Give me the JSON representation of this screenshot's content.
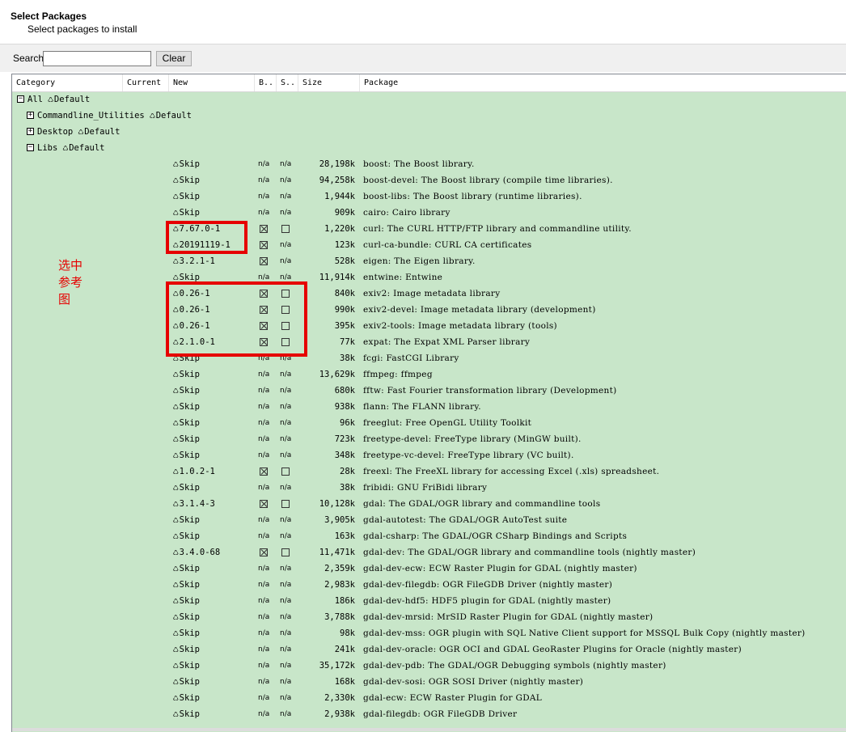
{
  "header": {
    "title": "Select Packages",
    "subtitle": "Select packages to install"
  },
  "search": {
    "label": "Search",
    "value": "",
    "placeholder": "",
    "clear_label": "Clear"
  },
  "columns": [
    "Category",
    "Current",
    "New",
    "B..",
    "S..",
    "Size",
    "Package"
  ],
  "tree": [
    {
      "expander": "⊟",
      "label": "All",
      "action": "Default"
    },
    {
      "expander": "⊞",
      "label": "Commandline_Utilities",
      "action": "Default"
    },
    {
      "expander": "⊞",
      "label": "Desktop",
      "action": "Default"
    },
    {
      "expander": "⊟",
      "label": "Libs",
      "action": "Default"
    }
  ],
  "annotation": "选中参考图",
  "packages": [
    {
      "new": "Skip",
      "bin": "n/a",
      "src": "n/a",
      "size": "28,198k",
      "package": "boost: The Boost library."
    },
    {
      "new": "Skip",
      "bin": "n/a",
      "src": "n/a",
      "size": "94,258k",
      "package": "boost-devel: The Boost library (compile time libraries)."
    },
    {
      "new": "Skip",
      "bin": "n/a",
      "src": "n/a",
      "size": "1,944k",
      "package": "boost-libs: The Boost library (runtime libraries)."
    },
    {
      "new": "Skip",
      "bin": "n/a",
      "src": "n/a",
      "size": "909k",
      "package": "cairo: Cairo library"
    },
    {
      "new": "7.67.0-1",
      "bin": "checked",
      "src": "unchecked",
      "size": "1,220k",
      "package": "curl: The CURL HTTP/FTP library and commandline utility."
    },
    {
      "new": "20191119-1",
      "bin": "checked",
      "src": "n/a",
      "size": "123k",
      "package": "curl-ca-bundle: CURL CA certificates"
    },
    {
      "new": "3.2.1-1",
      "bin": "checked",
      "src": "n/a",
      "size": "528k",
      "package": "eigen: The Eigen library."
    },
    {
      "new": "Skip",
      "bin": "n/a",
      "src": "n/a",
      "size": "11,914k",
      "package": "entwine: Entwine"
    },
    {
      "new": "0.26-1",
      "bin": "checked",
      "src": "unchecked",
      "size": "840k",
      "package": "exiv2: Image metadata library"
    },
    {
      "new": "0.26-1",
      "bin": "checked",
      "src": "unchecked",
      "size": "990k",
      "package": "exiv2-devel: Image metadata library (development)"
    },
    {
      "new": "0.26-1",
      "bin": "checked",
      "src": "unchecked",
      "size": "395k",
      "package": "exiv2-tools: Image metadata library (tools)"
    },
    {
      "new": "2.1.0-1",
      "bin": "checked",
      "src": "unchecked",
      "size": "77k",
      "package": "expat: The Expat XML Parser library"
    },
    {
      "new": "Skip",
      "bin": "n/a",
      "src": "n/a",
      "size": "38k",
      "package": "fcgi: FastCGI Library"
    },
    {
      "new": "Skip",
      "bin": "n/a",
      "src": "n/a",
      "size": "13,629k",
      "package": "ffmpeg: ffmpeg"
    },
    {
      "new": "Skip",
      "bin": "n/a",
      "src": "n/a",
      "size": "680k",
      "package": "fftw: Fast Fourier transformation library (Development)"
    },
    {
      "new": "Skip",
      "bin": "n/a",
      "src": "n/a",
      "size": "938k",
      "package": "flann: The FLANN library."
    },
    {
      "new": "Skip",
      "bin": "n/a",
      "src": "n/a",
      "size": "96k",
      "package": "freeglut: Free OpenGL Utility Toolkit"
    },
    {
      "new": "Skip",
      "bin": "n/a",
      "src": "n/a",
      "size": "723k",
      "package": "freetype-devel: FreeType library (MinGW built)."
    },
    {
      "new": "Skip",
      "bin": "n/a",
      "src": "n/a",
      "size": "348k",
      "package": "freetype-vc-devel: FreeType library (VC built)."
    },
    {
      "new": "1.0.2-1",
      "bin": "checked",
      "src": "unchecked",
      "size": "28k",
      "package": "freexl: The FreeXL library for accessing Excel (.xls) spreadsheet."
    },
    {
      "new": "Skip",
      "bin": "n/a",
      "src": "n/a",
      "size": "38k",
      "package": "fribidi: GNU FriBidi library"
    },
    {
      "new": "3.1.4-3",
      "bin": "checked",
      "src": "unchecked",
      "size": "10,128k",
      "package": "gdal: The GDAL/OGR library and commandline tools"
    },
    {
      "new": "Skip",
      "bin": "n/a",
      "src": "n/a",
      "size": "3,905k",
      "package": "gdal-autotest: The GDAL/OGR AutoTest suite"
    },
    {
      "new": "Skip",
      "bin": "n/a",
      "src": "n/a",
      "size": "163k",
      "package": "gdal-csharp: The GDAL/OGR CSharp Bindings and Scripts"
    },
    {
      "new": "3.4.0-68",
      "bin": "checked",
      "src": "unchecked",
      "size": "11,471k",
      "package": "gdal-dev: The GDAL/OGR library and commandline tools (nightly master)"
    },
    {
      "new": "Skip",
      "bin": "n/a",
      "src": "n/a",
      "size": "2,359k",
      "package": "gdal-dev-ecw: ECW Raster Plugin for GDAL (nightly master)"
    },
    {
      "new": "Skip",
      "bin": "n/a",
      "src": "n/a",
      "size": "2,983k",
      "package": "gdal-dev-filegdb: OGR FileGDB Driver (nightly master)"
    },
    {
      "new": "Skip",
      "bin": "n/a",
      "src": "n/a",
      "size": "186k",
      "package": "gdal-dev-hdf5: HDF5 plugin for GDAL (nightly master)"
    },
    {
      "new": "Skip",
      "bin": "n/a",
      "src": "n/a",
      "size": "3,788k",
      "package": "gdal-dev-mrsid: MrSID Raster Plugin for GDAL (nightly master)"
    },
    {
      "new": "Skip",
      "bin": "n/a",
      "src": "n/a",
      "size": "98k",
      "package": "gdal-dev-mss: OGR plugin with SQL Native Client support for MSSQL Bulk Copy (nightly master)"
    },
    {
      "new": "Skip",
      "bin": "n/a",
      "src": "n/a",
      "size": "241k",
      "package": "gdal-dev-oracle: OGR OCI and GDAL GeoRaster Plugins for Oracle (nightly master)"
    },
    {
      "new": "Skip",
      "bin": "n/a",
      "src": "n/a",
      "size": "35,172k",
      "package": "gdal-dev-pdb: The GDAL/OGR Debugging symbols (nightly master)"
    },
    {
      "new": "Skip",
      "bin": "n/a",
      "src": "n/a",
      "size": "168k",
      "package": "gdal-dev-sosi: OGR SOSI Driver (nightly master)"
    },
    {
      "new": "Skip",
      "bin": "n/a",
      "src": "n/a",
      "size": "2,330k",
      "package": "gdal-ecw: ECW Raster Plugin for GDAL"
    },
    {
      "new": "Skip",
      "bin": "n/a",
      "src": "n/a",
      "size": "2,938k",
      "package": "gdal-filegdb: OGR FileGDB Driver"
    }
  ]
}
